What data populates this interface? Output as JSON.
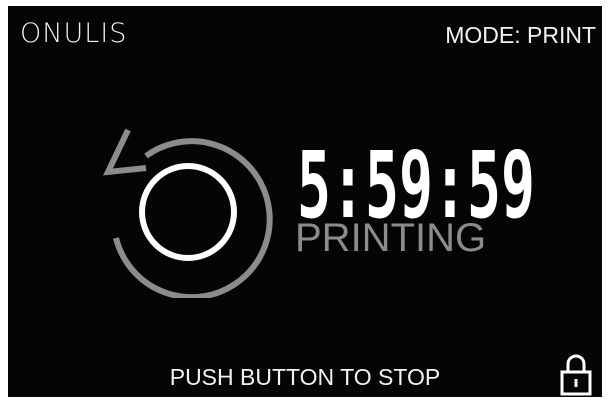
{
  "header": {
    "brand": "ONULIS",
    "mode": "MODE: PRINT"
  },
  "timer": {
    "time": "5:59:59",
    "status": "PRINTING"
  },
  "footer": {
    "instruction": "PUSH BUTTON TO STOP"
  },
  "icons": {
    "reset": "circular-arrow-icon",
    "lock": "padlock-icon"
  },
  "colors": {
    "background": "#050505",
    "text": "#f2f2f2",
    "muted": "#8c8c8c"
  }
}
